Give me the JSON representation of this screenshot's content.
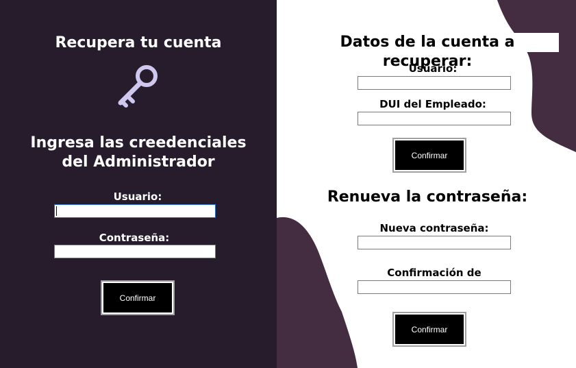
{
  "left_panel": {
    "title": "Recupera tu cuenta",
    "icon": "key-icon",
    "subtitle_line1": "Ingresa las creedenciales",
    "subtitle_line2": "del Administrador",
    "username_label": "Usuario:",
    "username_value": "",
    "password_label": "Contraseña:",
    "password_value": "",
    "confirm_label": "Confirmar"
  },
  "right_panel": {
    "account_title": "Datos de la cuenta a recuperar:",
    "username_label": "Usuario:",
    "username_value": "",
    "dui_label": "DUI del Empleado:",
    "dui_value": "",
    "confirm_label_1": "Confirmar",
    "renew_title": "Renueva la contraseña:",
    "new_password_label": "Nueva contraseña:",
    "new_password_value": "",
    "confirm_password_label": "Confirmación de contraseña:",
    "confirm_password_value": "",
    "confirm_label_2": "Confirmar"
  },
  "colors": {
    "dark_panel": "#261c2c",
    "blob": "#452d41",
    "key": "#cfc8ee",
    "button": "#000000"
  }
}
